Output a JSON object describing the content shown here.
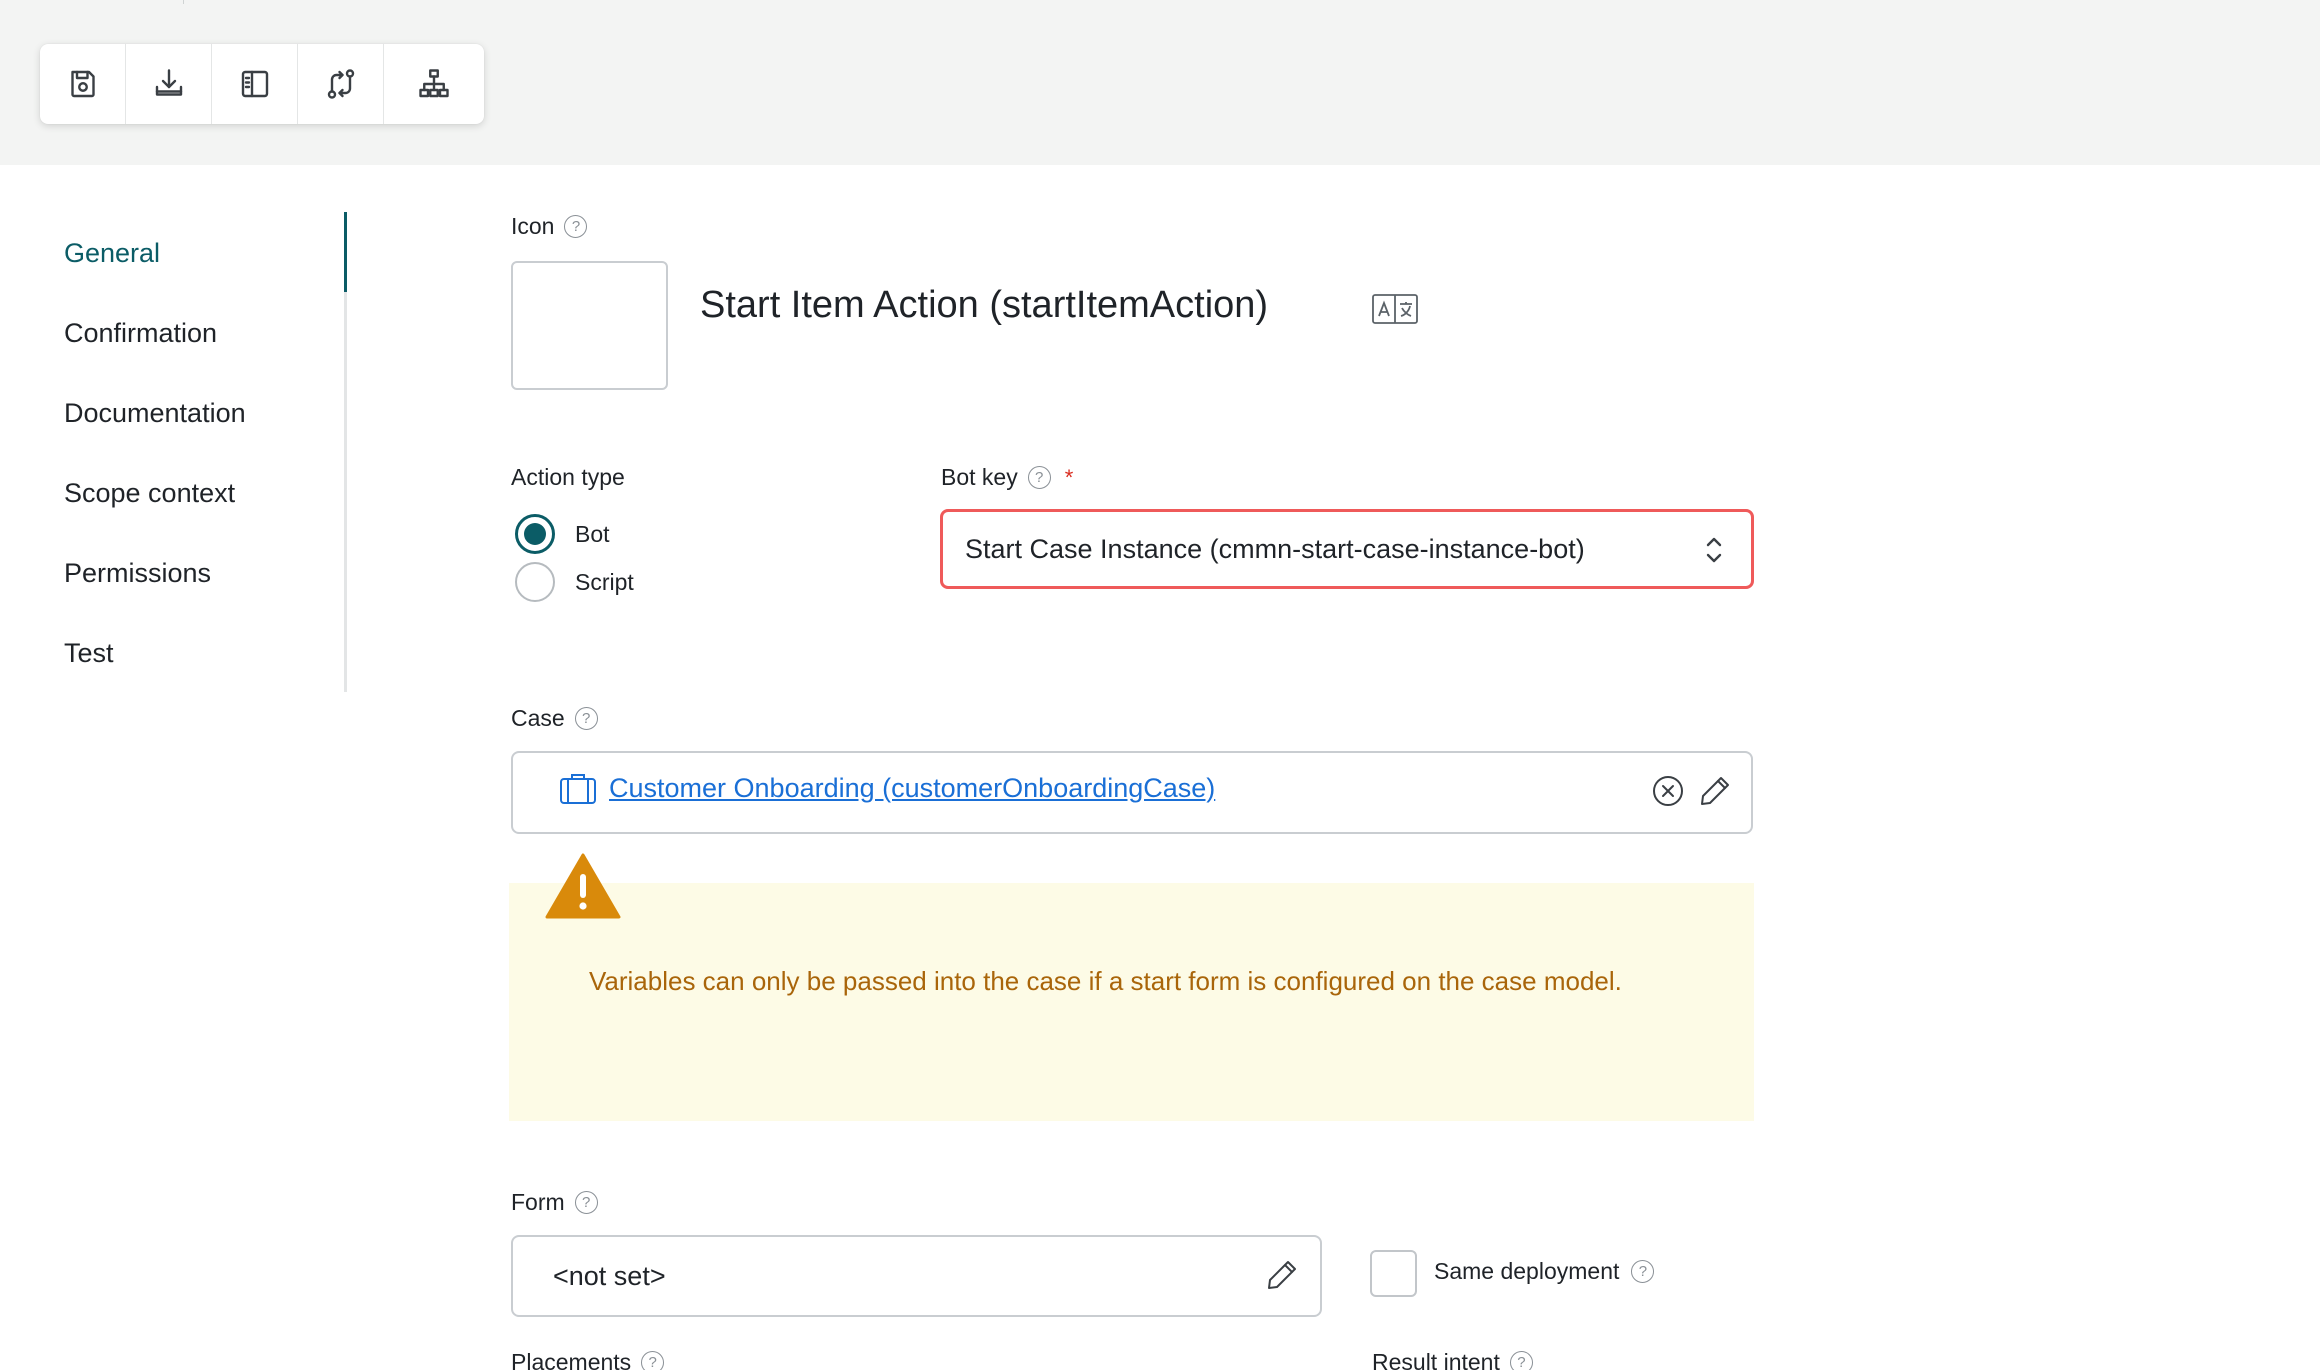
{
  "toolbar": {
    "buttons": [
      {
        "name": "save-icon"
      },
      {
        "name": "download-icon"
      },
      {
        "name": "sidebar-panel-icon"
      },
      {
        "name": "compare-icon"
      },
      {
        "name": "hierarchy-icon"
      }
    ]
  },
  "nav": {
    "items": [
      {
        "label": "General",
        "active": true
      },
      {
        "label": "Confirmation"
      },
      {
        "label": "Documentation"
      },
      {
        "label": "Scope context"
      },
      {
        "label": "Permissions"
      },
      {
        "label": "Test"
      }
    ]
  },
  "form": {
    "icon_label": "Icon",
    "title": "Start Item Action (startItemAction)",
    "action_type": {
      "label": "Action type",
      "options": [
        {
          "label": "Bot",
          "checked": true
        },
        {
          "label": "Script",
          "checked": false
        }
      ]
    },
    "bot_key": {
      "label": "Bot key",
      "required_mark": "*",
      "value": "Start Case Instance (cmmn-start-case-instance-bot)"
    },
    "case": {
      "label": "Case",
      "value": "Customer Onboarding (customerOnboardingCase)"
    },
    "warning": "Variables can only be passed into the case if a start form is configured on the case model.",
    "form_field": {
      "label": "Form",
      "value": "<not set>"
    },
    "same_deployment": {
      "label": "Same deployment",
      "checked": false
    },
    "placements_label": "Placements",
    "result_intent_label": "Result intent"
  },
  "colors": {
    "accent": "#0b5c66",
    "error_border": "#ef5a5a",
    "link": "#1a6fd6",
    "warning_bg": "#fdfbe6",
    "warning_text": "#a9650a",
    "warning_icon": "#d98a0b"
  }
}
